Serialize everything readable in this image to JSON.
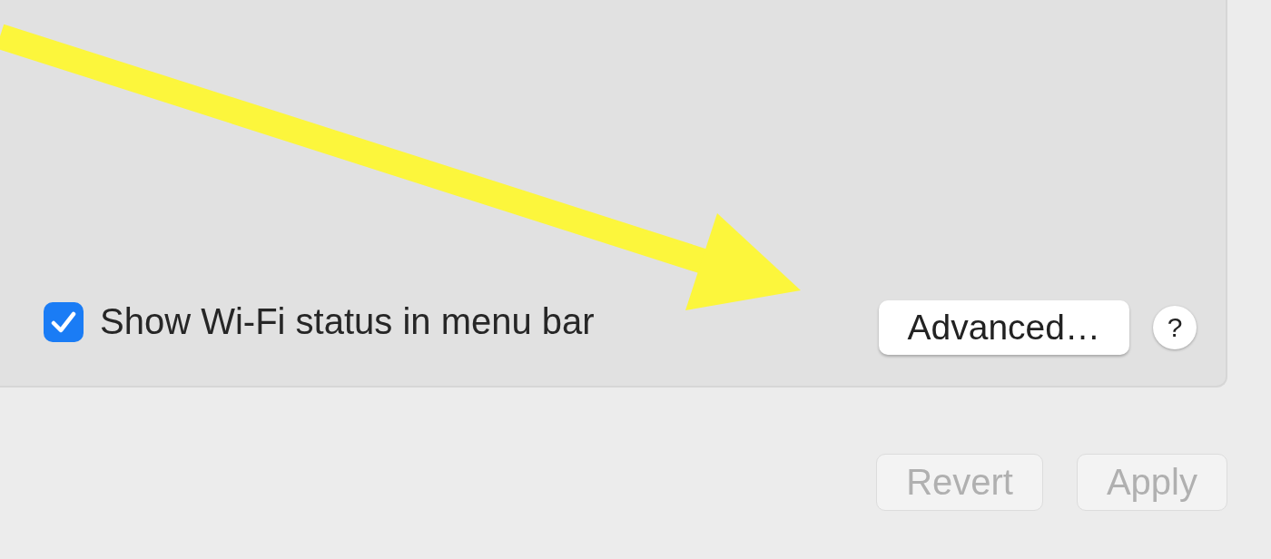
{
  "show_status_checkbox": {
    "label": "Show Wi-Fi status in menu bar",
    "checked": true
  },
  "advanced_button": {
    "label": "Advanced…"
  },
  "help_button": {
    "label": "?"
  },
  "buttons": [
    {
      "label": "Revert",
      "disabled": true
    },
    {
      "label": "Apply",
      "disabled": true
    }
  ]
}
